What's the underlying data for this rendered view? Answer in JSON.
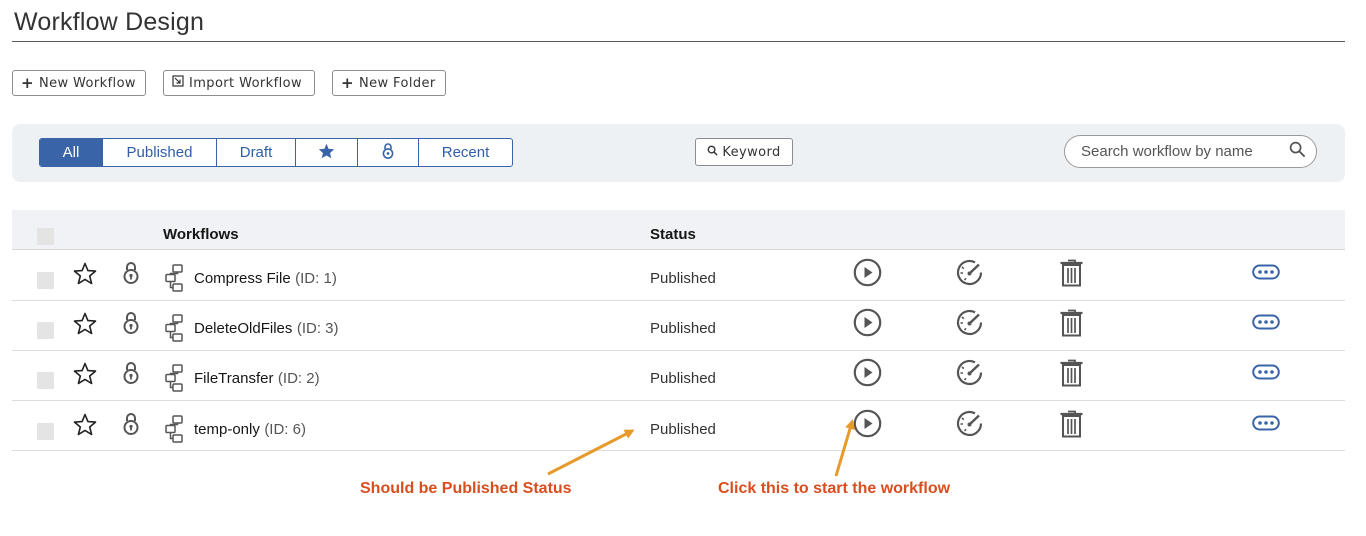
{
  "page": {
    "title": "Workflow Design"
  },
  "toolbar": {
    "new_workflow": "New Workflow",
    "import_workflow": "Import Workflow",
    "new_folder": "New Folder"
  },
  "filters": {
    "tabs": [
      "All",
      "Published",
      "Draft"
    ],
    "recent": "Recent",
    "active": "All",
    "keyword": "Keyword"
  },
  "search": {
    "placeholder": "Search workflow by name"
  },
  "table": {
    "col_workflows": "Workflows",
    "col_status": "Status",
    "rows": [
      {
        "name": "Compress File",
        "id": "(ID: 1)",
        "status": "Published"
      },
      {
        "name": "DeleteOldFiles",
        "id": "(ID: 3)",
        "status": "Published"
      },
      {
        "name": "FileTransfer",
        "id": "(ID: 2)",
        "status": "Published"
      },
      {
        "name": "temp-only",
        "id": "(ID: 6)",
        "status": "Published"
      }
    ]
  },
  "annotations": {
    "status_note": "Should be Published Status",
    "start_note": "Click this to start the workflow"
  },
  "colors": {
    "accent": "#3a64a8",
    "annotation": "#d94e1f",
    "arrow": "#e69a2a",
    "icon": "#555555"
  }
}
